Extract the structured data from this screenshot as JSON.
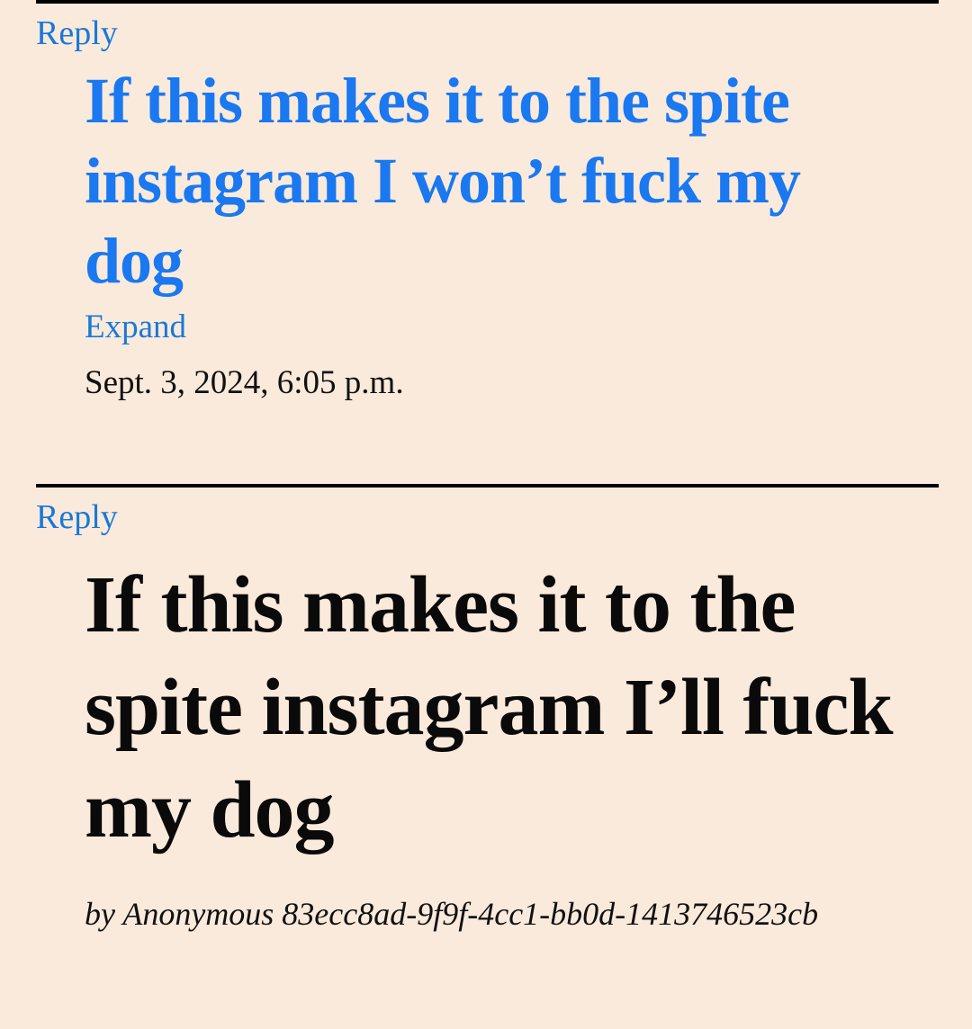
{
  "colors": {
    "background": "#faeadb",
    "link": "#1a78f0",
    "text": "#0a0a0a",
    "divider": "#000000"
  },
  "comments": [
    {
      "reply_label": "Reply",
      "title": "If this makes it to the spite instagram I won’t fuck my dog",
      "expand_label": "Expand",
      "timestamp": "Sept. 3, 2024, 6:05 p.m."
    }
  ],
  "main_post": {
    "reply_label": "Reply",
    "title": "If this makes it to the spite instagram I’ll fuck my dog",
    "byline": "by Anonymous 83ecc8ad-9f9f-4cc1-bb0d-1413746523cb"
  }
}
